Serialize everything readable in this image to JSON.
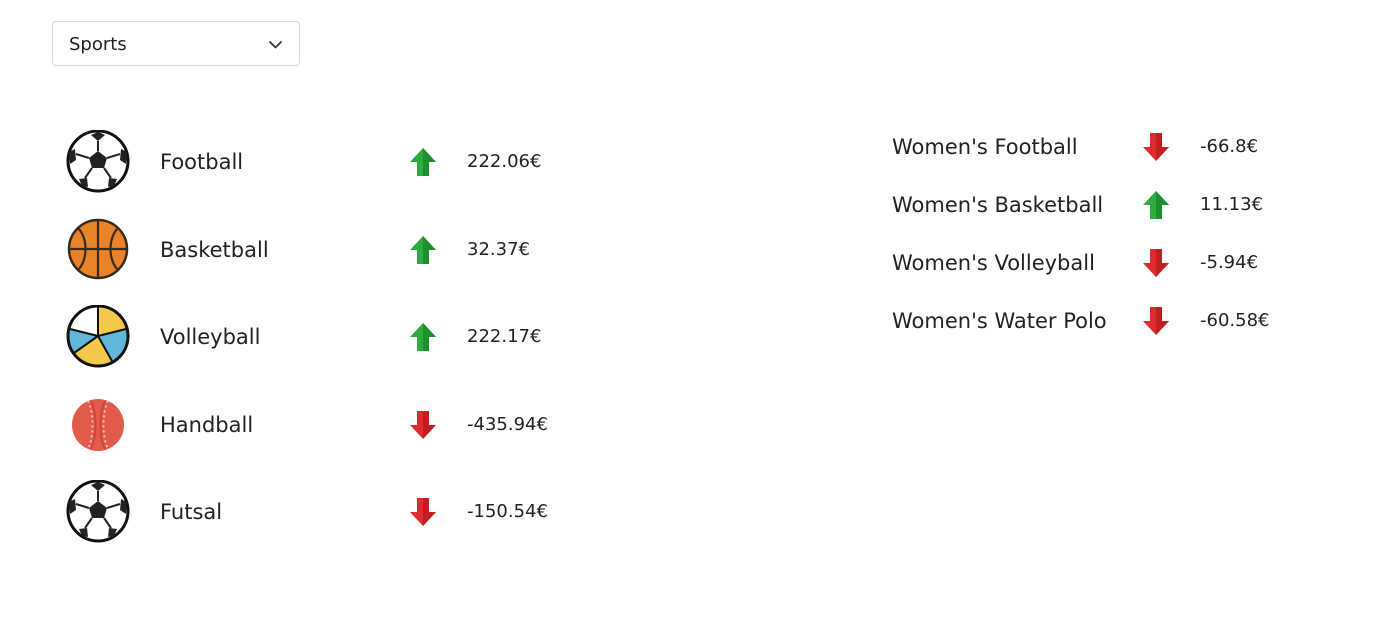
{
  "dropdown": {
    "selected": "Sports",
    "chevron_icon": "chevron-down-icon"
  },
  "colors": {
    "up": "#2eaa3e",
    "down": "#dd2b2e",
    "text": "#222222",
    "border": "#d8d8d8"
  },
  "sports": [
    {
      "name": "Football",
      "icon": "soccer-ball-icon",
      "trend": "up",
      "price": "222.06€"
    },
    {
      "name": "Basketball",
      "icon": "basketball-icon",
      "trend": "up",
      "price": "32.37€"
    },
    {
      "name": "Volleyball",
      "icon": "volleyball-icon",
      "trend": "up",
      "price": "222.17€"
    },
    {
      "name": "Handball",
      "icon": "red-ball-icon",
      "trend": "down",
      "price": "-435.94€"
    },
    {
      "name": "Futsal",
      "icon": "soccer-ball-icon",
      "trend": "down",
      "price": "-150.54€"
    }
  ],
  "womens_sports": [
    {
      "name": "Women's Football",
      "trend": "down",
      "price": "-66.8€"
    },
    {
      "name": "Women's Basketball",
      "trend": "up",
      "price": "11.13€"
    },
    {
      "name": "Women's Volleyball",
      "trend": "down",
      "price": "-5.94€"
    },
    {
      "name": "Women's Water Polo",
      "trend": "down",
      "price": "-60.58€"
    }
  ]
}
